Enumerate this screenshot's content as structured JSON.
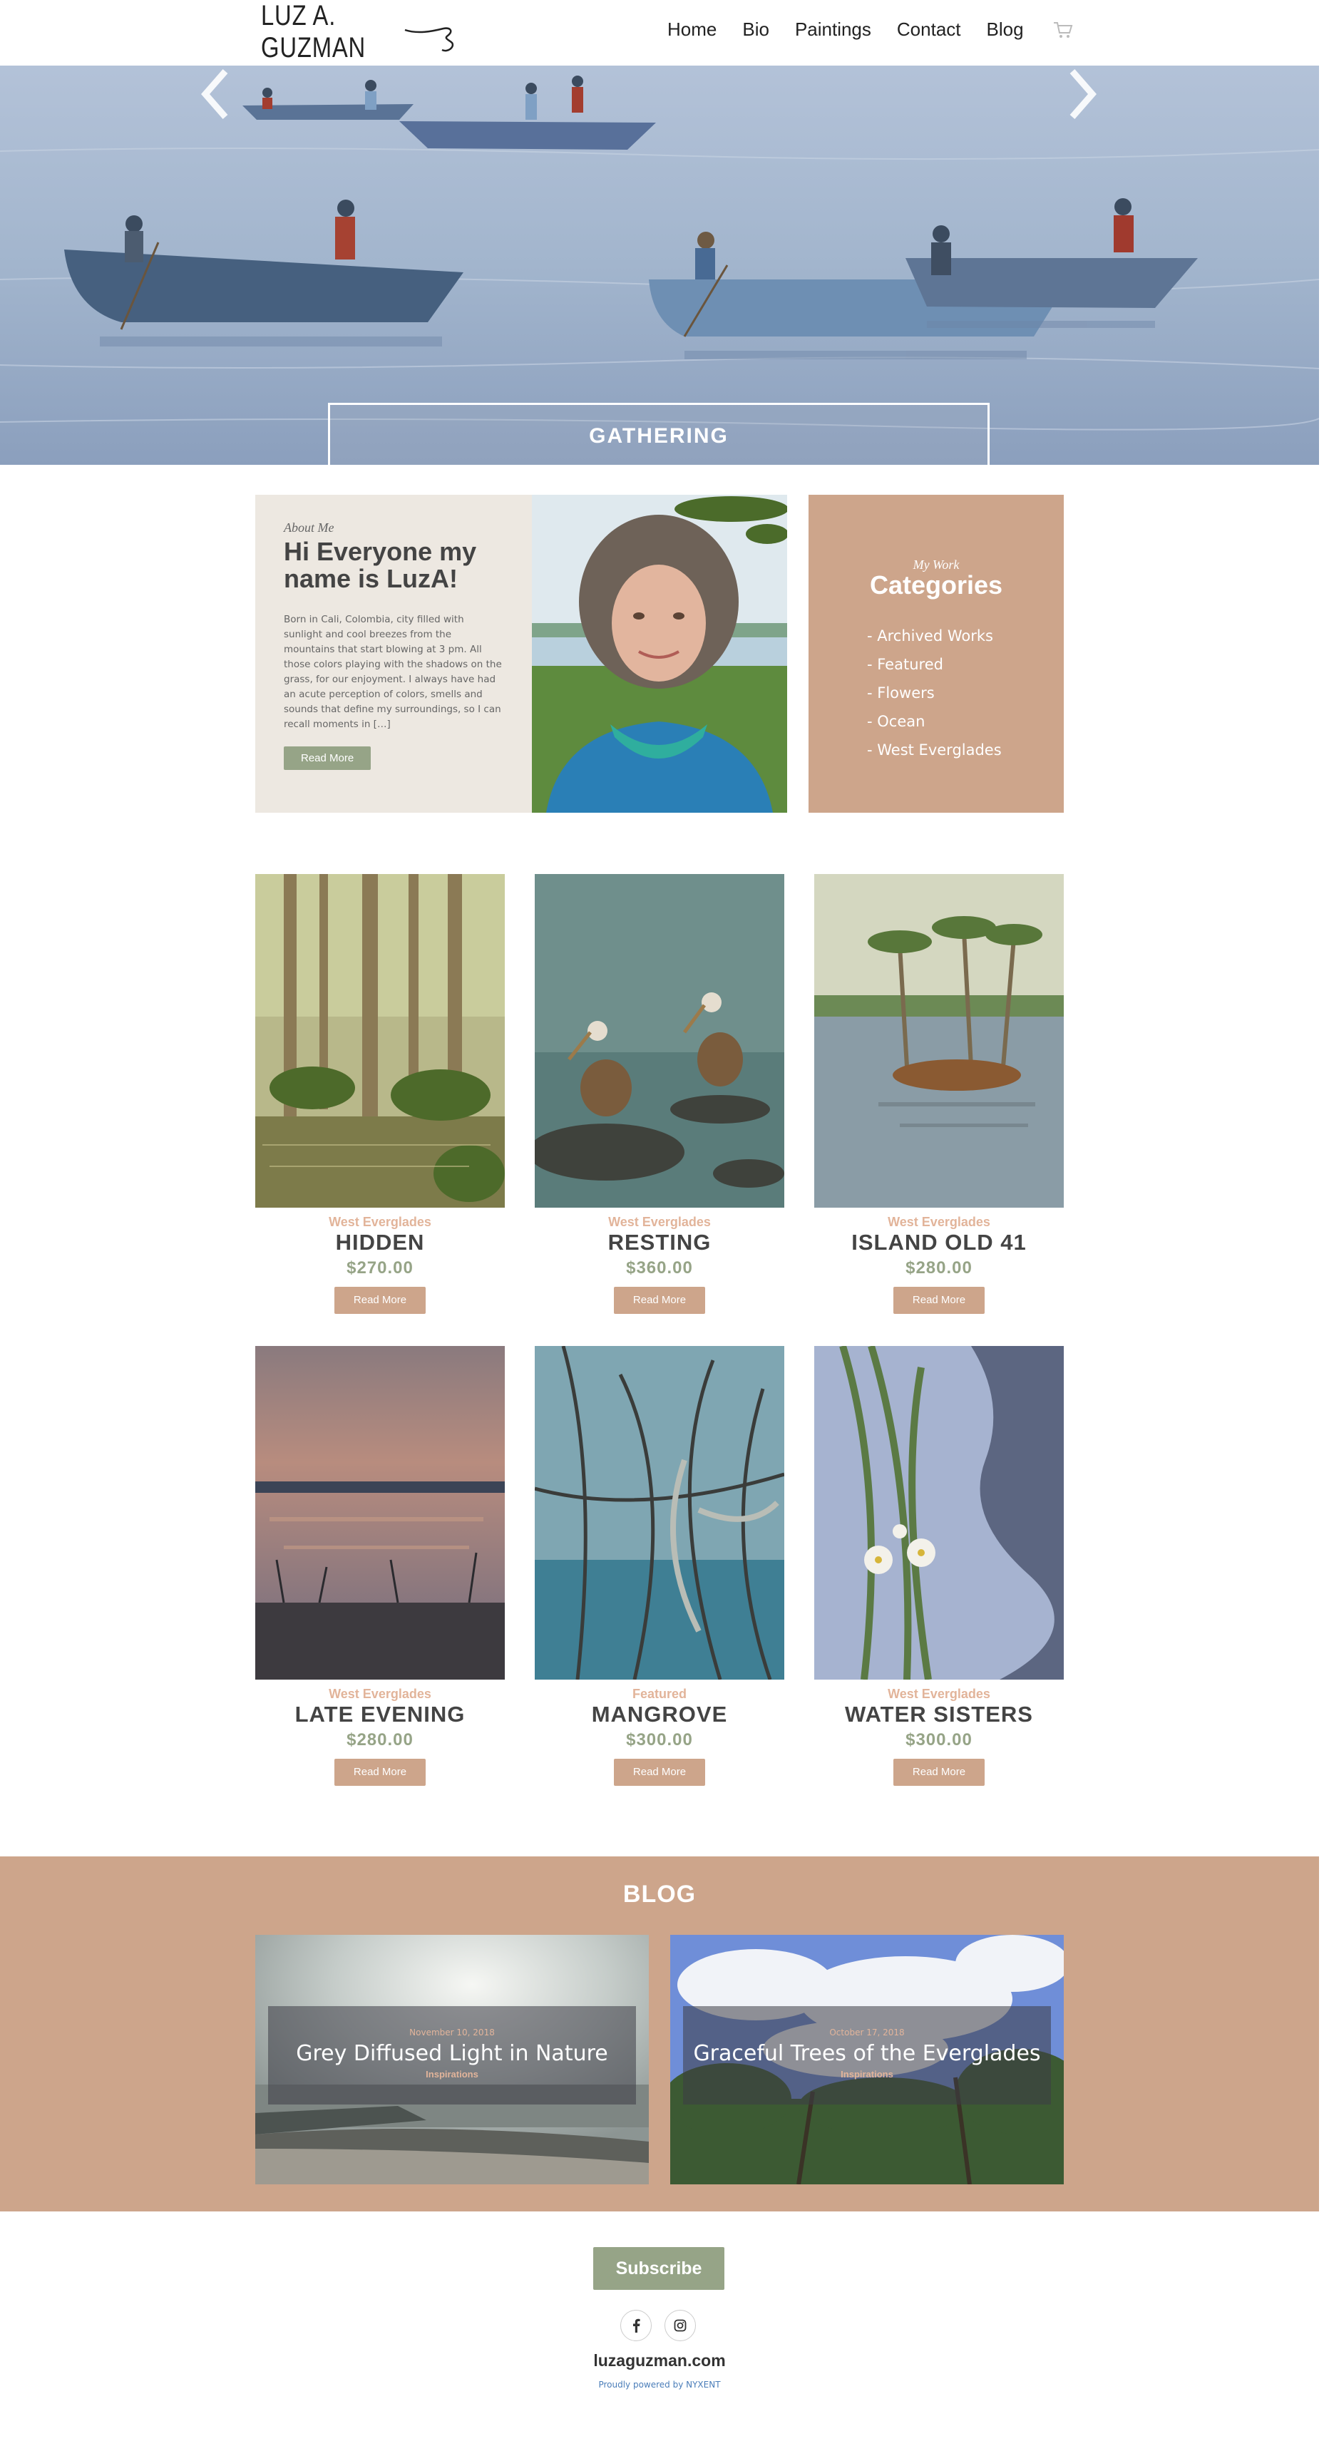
{
  "header": {
    "logo_text": "LUZ A. GUZMAN",
    "nav": [
      "Home",
      "Bio",
      "Paintings",
      "Contact",
      "Blog"
    ],
    "cart_icon": "shopping-cart-icon"
  },
  "hero": {
    "caption": "GATHERING",
    "prev_icon": "chevron-left-icon",
    "next_icon": "chevron-right-icon"
  },
  "about": {
    "subtitle": "About Me",
    "title": "Hi Everyone my name is LuzA!",
    "body": "Born in Cali, Colombia, city filled with sunlight and cool breezes from the mountains that start blowing at 3 pm. All those colors playing with the shadows on the grass, for our enjoyment. I always have had an acute perception of colors, smells and sounds that define my surroundings, so I can recall moments in […]",
    "button": "Read More"
  },
  "categories": {
    "subtitle": "My Work",
    "title": "Categories",
    "items": [
      "- Archived Works",
      "- Featured",
      "- Flowers",
      "- Ocean",
      "- West Everglades"
    ]
  },
  "products": [
    {
      "category": "West Everglades",
      "name": "HIDDEN",
      "price": "$270.00",
      "button": "Read More"
    },
    {
      "category": "West Everglades",
      "name": "RESTING",
      "price": "$360.00",
      "button": "Read More"
    },
    {
      "category": "West Everglades",
      "name": "ISLAND OLD 41",
      "price": "$280.00",
      "button": "Read More"
    },
    {
      "category": "West Everglades",
      "name": "LATE EVENING",
      "price": "$280.00",
      "button": "Read More"
    },
    {
      "category": "Featured",
      "name": "MANGROVE",
      "price": "$300.00",
      "button": "Read More"
    },
    {
      "category": "West Everglades",
      "name": "WATER SISTERS",
      "price": "$300.00",
      "button": "Read More"
    }
  ],
  "blog": {
    "title": "BLOG",
    "posts": [
      {
        "date": "November 10, 2018",
        "title": "Grey Diffused Light in Nature",
        "category": "Inspirations"
      },
      {
        "date": "October 17, 2018",
        "title": "Graceful Trees of the Everglades",
        "category": "Inspirations"
      }
    ]
  },
  "footer": {
    "subscribe": "Subscribe",
    "social": [
      "facebook-icon",
      "instagram-icon"
    ],
    "site_name": "luzaguzman.com",
    "powered": "Proudly powered by NYXENT"
  },
  "colors": {
    "tan": "#cda58b",
    "sage": "#96a487",
    "light_tan_text": "#e2b49a",
    "about_bg": "#ede8e1"
  }
}
